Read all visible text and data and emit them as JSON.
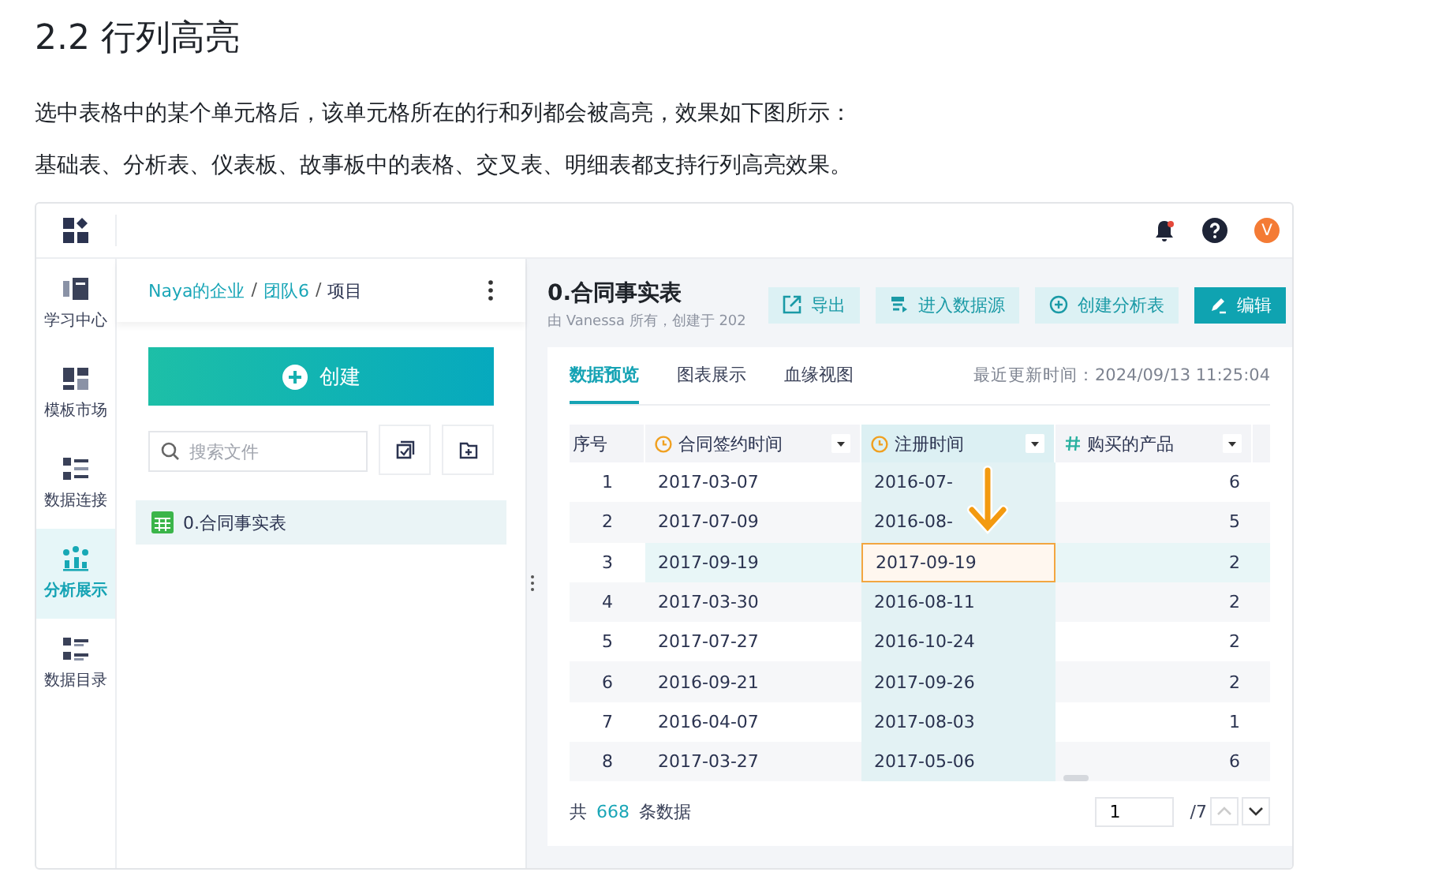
{
  "heading": "2.2 行列高亮",
  "paragraphs": [
    "选中表格中的某个单元格后，该单元格所在的行和列都会被高亮，效果如下图所示：",
    "基础表、分析表、仪表板、故事板中的表格、交叉表、明细表都支持行列高亮效果。"
  ],
  "app": {
    "avatar": "V",
    "nav": [
      {
        "label": "学习中心",
        "kind": "learn",
        "selected": false
      },
      {
        "label": "模板市场",
        "kind": "template",
        "selected": false
      },
      {
        "label": "数据连接",
        "kind": "connect",
        "selected": false
      },
      {
        "label": "分析展示",
        "kind": "analysis",
        "selected": true
      },
      {
        "label": "数据目录",
        "kind": "catalog",
        "selected": false
      }
    ],
    "breadcrumb": [
      {
        "label": "Naya的企业",
        "kind": "link"
      },
      {
        "separator": "/",
        "label": "团队6",
        "kind": "link"
      },
      {
        "separator": "/",
        "label": "项目",
        "kind": "current"
      }
    ],
    "create_button": "创建",
    "search": {
      "placeholder": "搜索文件"
    },
    "files": [
      {
        "name": "0.合同事实表",
        "selected": true
      }
    ],
    "title": "0.合同事实表",
    "subtitle": "由 Vanessa 所有，创建于 202",
    "actions": [
      {
        "label": "导出",
        "kind": "export"
      },
      {
        "label": "进入数据源",
        "kind": "source"
      },
      {
        "label": "创建分析表",
        "kind": "create"
      },
      {
        "label": "编辑",
        "kind": "edit"
      }
    ],
    "tabs": [
      {
        "label": "数据预览",
        "selected": true
      },
      {
        "label": "图表展示",
        "selected": false
      },
      {
        "label": "血缘视图",
        "selected": false
      }
    ],
    "updated": "最近更新时间：2024/09/13 11:25:04",
    "table": {
      "columns": [
        {
          "label": "序号",
          "kind": "index",
          "selected": false
        },
        {
          "label": "合同签约时间",
          "kind": "time",
          "selected": false
        },
        {
          "label": "注册时间",
          "kind": "time",
          "selected": true
        },
        {
          "label": "购买的产品",
          "kind": "number",
          "selected": false
        }
      ],
      "rows": [
        {
          "selected": false,
          "cells": [
            "1",
            "2017-03-07",
            "2016-07-",
            "6"
          ]
        },
        {
          "selected": false,
          "cells": [
            "2",
            "2017-07-09",
            "2016-08-",
            "5"
          ]
        },
        {
          "selected": true,
          "cells": [
            "3",
            "2017-09-19",
            "2017-09-19",
            "2"
          ]
        },
        {
          "selected": false,
          "cells": [
            "4",
            "2017-03-30",
            "2016-08-11",
            "2"
          ]
        },
        {
          "selected": false,
          "cells": [
            "5",
            "2017-07-27",
            "2016-10-24",
            "2"
          ]
        },
        {
          "selected": false,
          "cells": [
            "6",
            "2016-09-21",
            "2017-09-26",
            "2"
          ]
        },
        {
          "selected": false,
          "cells": [
            "7",
            "2016-04-07",
            "2017-08-03",
            "1"
          ]
        },
        {
          "selected": false,
          "cells": [
            "8",
            "2017-03-27",
            "2017-05-06",
            "6"
          ]
        }
      ]
    },
    "footer": {
      "prefix": "共",
      "total": "668",
      "suffix": "条数据",
      "page": "1",
      "pages": "/7"
    }
  }
}
